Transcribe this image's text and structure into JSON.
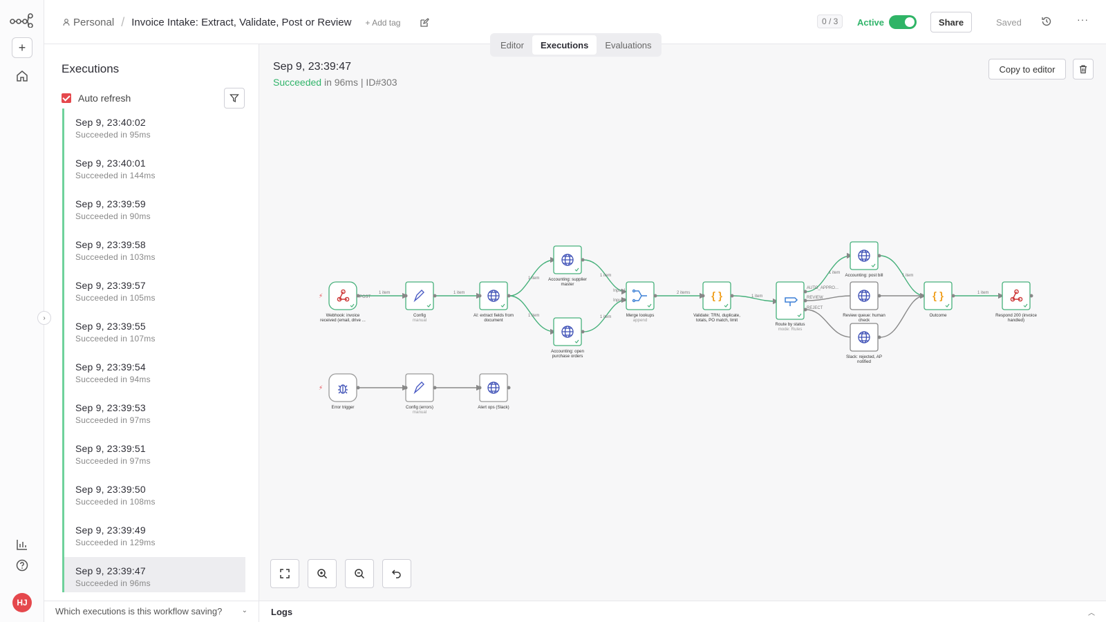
{
  "rail": {
    "avatar_initials": "HJ",
    "add_label": "+"
  },
  "header": {
    "project": "Personal",
    "workflow_name": "Invoice Intake: Extract, Validate, Post or Review",
    "add_tag": "+ Add tag",
    "counter": "0 / 3",
    "active_label": "Active",
    "share_label": "Share",
    "saved_label": "Saved",
    "more_label": "···"
  },
  "tabs": [
    {
      "label": "Editor",
      "selected": false
    },
    {
      "label": "Executions",
      "selected": true
    },
    {
      "label": "Evaluations",
      "selected": false
    }
  ],
  "executions": {
    "title": "Executions",
    "auto_refresh_label": "Auto refresh",
    "auto_refresh_checked": true,
    "items": [
      {
        "time": "Sep 9, 23:40:02",
        "status": "Succeeded in 95ms"
      },
      {
        "time": "Sep 9, 23:40:01",
        "status": "Succeeded in 144ms"
      },
      {
        "time": "Sep 9, 23:39:59",
        "status": "Succeeded in 90ms"
      },
      {
        "time": "Sep 9, 23:39:58",
        "status": "Succeeded in 103ms"
      },
      {
        "time": "Sep 9, 23:39:57",
        "status": "Succeeded in 105ms"
      },
      {
        "time": "Sep 9, 23:39:55",
        "status": "Succeeded in 107ms"
      },
      {
        "time": "Sep 9, 23:39:54",
        "status": "Succeeded in 94ms"
      },
      {
        "time": "Sep 9, 23:39:53",
        "status": "Succeeded in 97ms"
      },
      {
        "time": "Sep 9, 23:39:51",
        "status": "Succeeded in 97ms"
      },
      {
        "time": "Sep 9, 23:39:50",
        "status": "Succeeded in 108ms"
      },
      {
        "time": "Sep 9, 23:39:49",
        "status": "Succeeded in 129ms"
      },
      {
        "time": "Sep 9, 23:39:47",
        "status": "Succeeded in 96ms",
        "selected": true
      }
    ],
    "footer_question": "Which executions is this workflow saving?"
  },
  "detail": {
    "time": "Sep 9, 23:39:47",
    "status_word": "Succeeded",
    "status_rest": " in 96ms | ID#303",
    "copy_label": "Copy to editor"
  },
  "workflow": {
    "nodes": {
      "webhook": {
        "label1": "Webhook: invoice",
        "label2": "received (email, drive ..."
      },
      "config": {
        "label1": "Config",
        "sub": "manual"
      },
      "ai": {
        "label1": "AI: extract fields from",
        "label2": "document"
      },
      "supplier": {
        "label1": "Accounting: supplier",
        "label2": "master"
      },
      "po": {
        "label1": "Accounting: open",
        "label2": "purchase orders"
      },
      "merge": {
        "label1": "Merge lookups",
        "sub": "append"
      },
      "validate": {
        "label1": "Validate: TRN, duplicate,",
        "label2": "totals, PO match, limit"
      },
      "route": {
        "label1": "Route by status",
        "sub": "mode: Rules"
      },
      "postbill": {
        "label1": "Accounting: post bill"
      },
      "review": {
        "label1": "Review queue: human",
        "label2": "check"
      },
      "slack": {
        "label1": "Slack: rejected, AP",
        "label2": "notified"
      },
      "outcome": {
        "label1": "Outcome"
      },
      "respond": {
        "label1": "Respond 200 (invoice",
        "label2": "handled)"
      },
      "errtrig": {
        "label1": "Error trigger"
      },
      "errcfg": {
        "label1": "Config (errors)",
        "sub": "manual"
      },
      "alert": {
        "label1": "Alert ops (Slack)"
      }
    },
    "edge_labels": {
      "e1": "1 item",
      "e2": "1 item",
      "e3": "1 item",
      "e4": "1 item",
      "e5": "1 item",
      "e6": "1 item",
      "e7": "2 items",
      "e8": "1 item",
      "e9": "1 item",
      "e10": "1 item",
      "post": "POST",
      "in1": "Input 1",
      "in2": "Input 2",
      "auto": "AUTO_APPRO...",
      "rev": "REVIEW",
      "rej": "REJECT"
    }
  },
  "logs": {
    "label": "Logs"
  }
}
